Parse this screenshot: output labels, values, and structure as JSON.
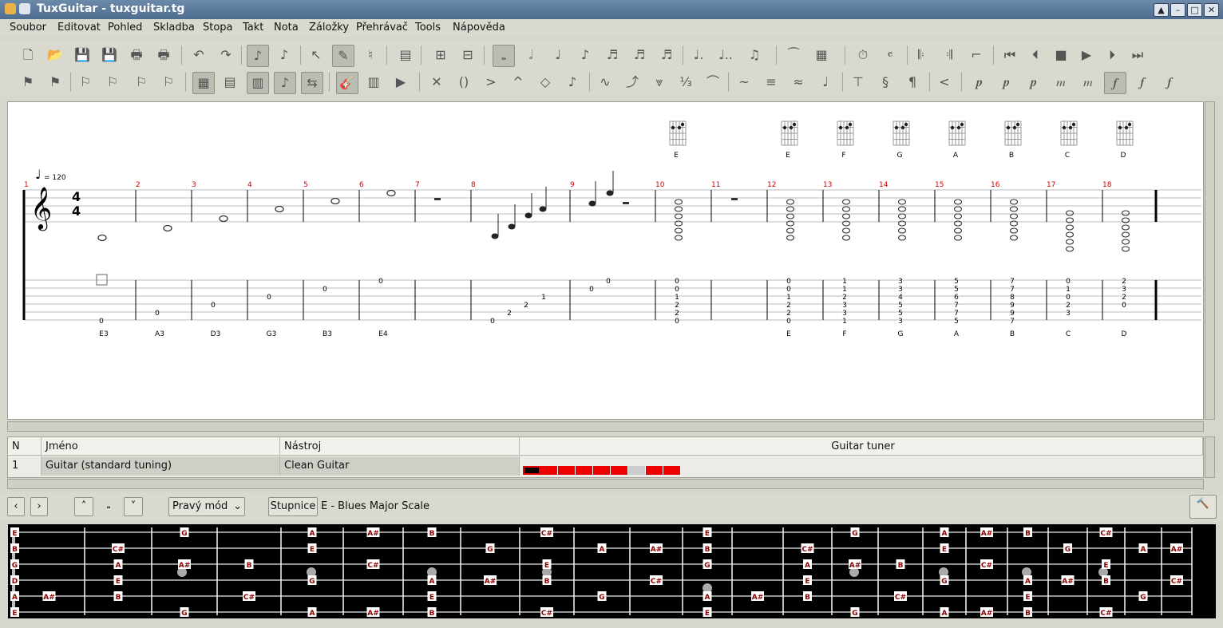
{
  "window": {
    "title": "TuxGuitar - tuxguitar.tg"
  },
  "menu": [
    "Soubor",
    "Editovat",
    "Pohled",
    "Skladba",
    "Stopa",
    "Takt",
    "Nota",
    "Záložky",
    "Přehrávač",
    "Tools",
    "Nápověda"
  ],
  "score": {
    "tempo": "= 120",
    "time_signature": {
      "top": "4",
      "bottom": "4"
    },
    "measure_numbers": [
      "1",
      "2",
      "3",
      "4",
      "5",
      "6",
      "7",
      "8",
      "9",
      "10",
      "11",
      "12",
      "13",
      "14",
      "15",
      "16",
      "17",
      "18"
    ],
    "chord_names": [
      "E",
      "E",
      "F",
      "G",
      "A",
      "B",
      "C",
      "D"
    ],
    "tab_numbers": [
      {
        "m": 1,
        "v": "0"
      },
      {
        "m": 2,
        "v": "0"
      },
      {
        "m": 3,
        "v": "0"
      },
      {
        "m": 4,
        "v": "0"
      },
      {
        "m": 5,
        "v": "0"
      },
      {
        "m": 6,
        "v": "0"
      },
      {
        "m": 8,
        "v": "0"
      },
      {
        "m": 8,
        "v": "2"
      },
      {
        "m": 8,
        "v": "2"
      },
      {
        "m": 8,
        "v": "1"
      },
      {
        "m": 9,
        "v": "0"
      },
      {
        "m": 9,
        "v": "0"
      }
    ],
    "chord_tabs": [
      {
        "m": 10,
        "frets": [
          "0",
          "0",
          "1",
          "2",
          "2",
          "0"
        ]
      },
      {
        "m": 12,
        "frets": [
          "0",
          "0",
          "1",
          "2",
          "2",
          "0"
        ]
      },
      {
        "m": 13,
        "frets": [
          "1",
          "1",
          "2",
          "3",
          "3",
          "1"
        ]
      },
      {
        "m": 14,
        "frets": [
          "3",
          "3",
          "4",
          "5",
          "5",
          "3"
        ]
      },
      {
        "m": 15,
        "frets": [
          "5",
          "5",
          "6",
          "7",
          "7",
          "5"
        ]
      },
      {
        "m": 16,
        "frets": [
          "7",
          "7",
          "8",
          "9",
          "9",
          "7"
        ]
      },
      {
        "m": 17,
        "frets": [
          "0",
          "1",
          "0",
          "2",
          "3",
          ""
        ]
      },
      {
        "m": 18,
        "frets": [
          "2",
          "3",
          "2",
          "0",
          "",
          ""
        ]
      }
    ],
    "bottom_labels": [
      {
        "m": 1,
        "t": "E3"
      },
      {
        "m": 2,
        "t": "A3"
      },
      {
        "m": 3,
        "t": "D3"
      },
      {
        "m": 4,
        "t": "G3"
      },
      {
        "m": 5,
        "t": "B3"
      },
      {
        "m": 6,
        "t": "E4"
      },
      {
        "m": 12,
        "t": "E"
      },
      {
        "m": 13,
        "t": "F"
      },
      {
        "m": 14,
        "t": "G"
      },
      {
        "m": 15,
        "t": "A"
      },
      {
        "m": 16,
        "t": "B"
      },
      {
        "m": 17,
        "t": "C"
      },
      {
        "m": 18,
        "t": "D"
      }
    ]
  },
  "tracks": {
    "headers": {
      "n": "N",
      "name": "Jméno",
      "instrument": "Nástroj",
      "tuner": "Guitar tuner"
    },
    "rows": [
      {
        "n": "1",
        "name": "Guitar (standard tuning)",
        "instrument": "Clean Guitar"
      }
    ]
  },
  "fretboard_toolbar": {
    "mode": "Pravý mód",
    "scale_button": "Stupnice",
    "scale_name": "E - Blues Major Scale"
  },
  "fretboard": {
    "strings": [
      "E",
      "B",
      "G",
      "D",
      "A",
      "E"
    ],
    "notes": [
      {
        "s": 0,
        "f": 3,
        "n": "G"
      },
      {
        "s": 0,
        "f": 5,
        "n": "A"
      },
      {
        "s": 0,
        "f": 6,
        "n": "A#"
      },
      {
        "s": 0,
        "f": 7,
        "n": "B"
      },
      {
        "s": 0,
        "f": 9,
        "n": "C#"
      },
      {
        "s": 0,
        "f": 12,
        "n": "E"
      },
      {
        "s": 0,
        "f": 15,
        "n": "G"
      },
      {
        "s": 0,
        "f": 17,
        "n": "A"
      },
      {
        "s": 0,
        "f": 18,
        "n": "A#"
      },
      {
        "s": 0,
        "f": 19,
        "n": "B"
      },
      {
        "s": 0,
        "f": 21,
        "n": "C#"
      },
      {
        "s": 1,
        "f": 2,
        "n": "C#"
      },
      {
        "s": 1,
        "f": 5,
        "n": "E"
      },
      {
        "s": 1,
        "f": 8,
        "n": "G"
      },
      {
        "s": 1,
        "f": 10,
        "n": "A"
      },
      {
        "s": 1,
        "f": 11,
        "n": "A#"
      },
      {
        "s": 1,
        "f": 12,
        "n": "B"
      },
      {
        "s": 1,
        "f": 14,
        "n": "C#"
      },
      {
        "s": 1,
        "f": 17,
        "n": "E"
      },
      {
        "s": 1,
        "f": 20,
        "n": "G"
      },
      {
        "s": 1,
        "f": 22,
        "n": "A"
      },
      {
        "s": 1,
        "f": 23,
        "n": "A#"
      },
      {
        "s": 2,
        "f": 2,
        "n": "A"
      },
      {
        "s": 2,
        "f": 3,
        "n": "A#"
      },
      {
        "s": 2,
        "f": 4,
        "n": "B"
      },
      {
        "s": 2,
        "f": 6,
        "n": "C#"
      },
      {
        "s": 2,
        "f": 9,
        "n": "E"
      },
      {
        "s": 2,
        "f": 12,
        "n": "G"
      },
      {
        "s": 2,
        "f": 14,
        "n": "A"
      },
      {
        "s": 2,
        "f": 15,
        "n": "A#"
      },
      {
        "s": 2,
        "f": 16,
        "n": "B"
      },
      {
        "s": 2,
        "f": 18,
        "n": "C#"
      },
      {
        "s": 2,
        "f": 21,
        "n": "E"
      },
      {
        "s": 3,
        "f": 2,
        "n": "E"
      },
      {
        "s": 3,
        "f": 5,
        "n": "G"
      },
      {
        "s": 3,
        "f": 7,
        "n": "A"
      },
      {
        "s": 3,
        "f": 8,
        "n": "A#"
      },
      {
        "s": 3,
        "f": 9,
        "n": "B"
      },
      {
        "s": 3,
        "f": 11,
        "n": "C#"
      },
      {
        "s": 3,
        "f": 14,
        "n": "E"
      },
      {
        "s": 3,
        "f": 17,
        "n": "G"
      },
      {
        "s": 3,
        "f": 19,
        "n": "A"
      },
      {
        "s": 3,
        "f": 20,
        "n": "A#"
      },
      {
        "s": 3,
        "f": 21,
        "n": "B"
      },
      {
        "s": 3,
        "f": 23,
        "n": "C#"
      },
      {
        "s": 4,
        "f": 1,
        "n": "A#"
      },
      {
        "s": 4,
        "f": 2,
        "n": "B"
      },
      {
        "s": 4,
        "f": 4,
        "n": "C#"
      },
      {
        "s": 4,
        "f": 7,
        "n": "E"
      },
      {
        "s": 4,
        "f": 10,
        "n": "G"
      },
      {
        "s": 4,
        "f": 12,
        "n": "A"
      },
      {
        "s": 4,
        "f": 13,
        "n": "A#"
      },
      {
        "s": 4,
        "f": 14,
        "n": "B"
      },
      {
        "s": 4,
        "f": 16,
        "n": "C#"
      },
      {
        "s": 4,
        "f": 19,
        "n": "E"
      },
      {
        "s": 4,
        "f": 22,
        "n": "G"
      },
      {
        "s": 5,
        "f": 3,
        "n": "G"
      },
      {
        "s": 5,
        "f": 5,
        "n": "A"
      },
      {
        "s": 5,
        "f": 6,
        "n": "A#"
      },
      {
        "s": 5,
        "f": 7,
        "n": "B"
      },
      {
        "s": 5,
        "f": 9,
        "n": "C#"
      },
      {
        "s": 5,
        "f": 12,
        "n": "E"
      },
      {
        "s": 5,
        "f": 15,
        "n": "G"
      },
      {
        "s": 5,
        "f": 17,
        "n": "A"
      },
      {
        "s": 5,
        "f": 18,
        "n": "A#"
      },
      {
        "s": 5,
        "f": 19,
        "n": "B"
      },
      {
        "s": 5,
        "f": 21,
        "n": "C#"
      }
    ]
  }
}
